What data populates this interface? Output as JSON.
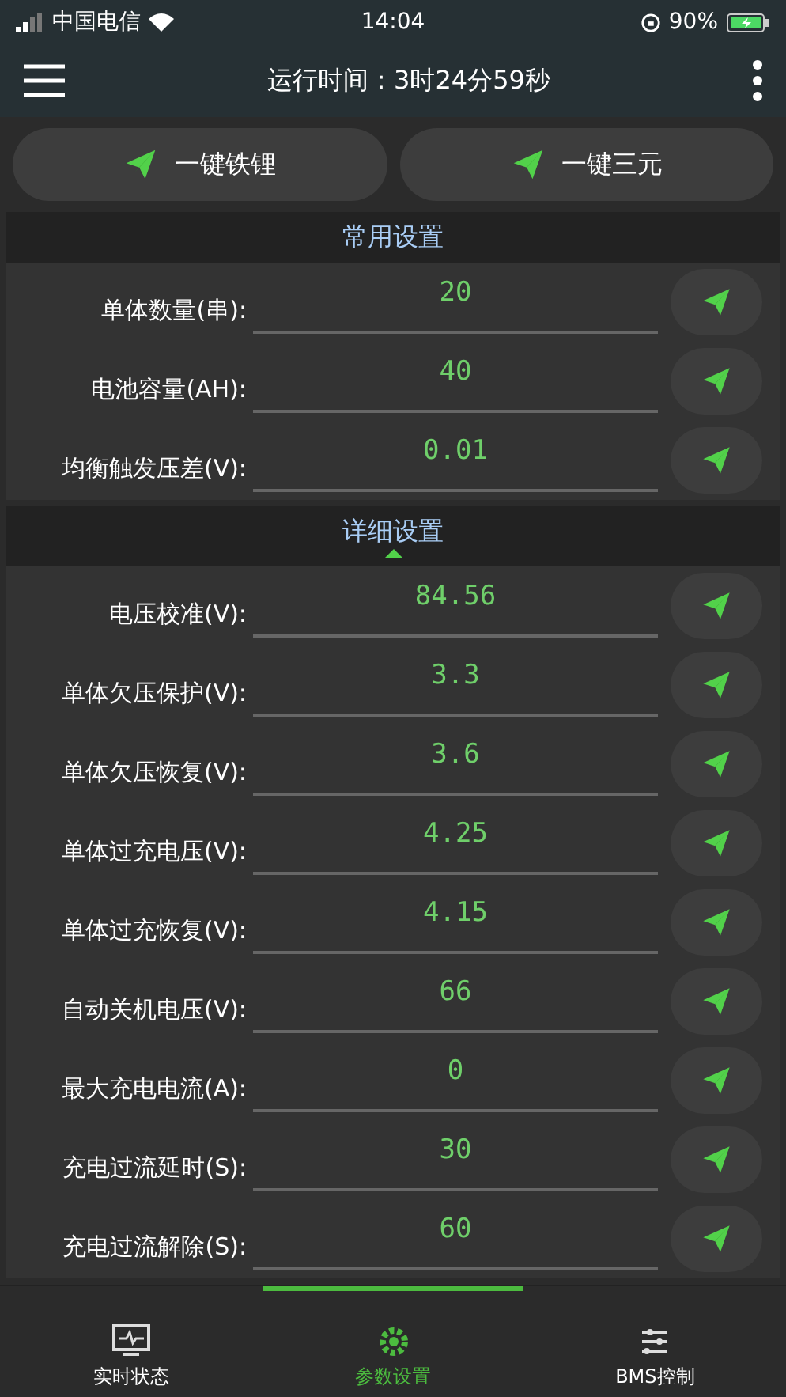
{
  "status_bar": {
    "carrier": "中国电信",
    "time": "14:04",
    "battery": "90%"
  },
  "header": {
    "title": "运行时间：3时24分59秒"
  },
  "quick_buttons": [
    "一键铁锂",
    "一键三元"
  ],
  "sections": [
    {
      "title": "常用设置",
      "expanded": false,
      "rows": [
        {
          "label": "单体数量(串):",
          "value": "20"
        },
        {
          "label": "电池容量(AH):",
          "value": "40"
        },
        {
          "label": "均衡触发压差(V):",
          "value": "0.01"
        }
      ]
    },
    {
      "title": "详细设置",
      "expanded": true,
      "rows": [
        {
          "label": "电压校准(V):",
          "value": "84.56"
        },
        {
          "label": "单体欠压保护(V):",
          "value": "3.3"
        },
        {
          "label": "单体欠压恢复(V):",
          "value": "3.6"
        },
        {
          "label": "单体过充电压(V):",
          "value": "4.25"
        },
        {
          "label": "单体过充恢复(V):",
          "value": "4.15"
        },
        {
          "label": "自动关机电压(V):",
          "value": "66"
        },
        {
          "label": "最大充电电流(A):",
          "value": "0"
        },
        {
          "label": "充电过流延时(S):",
          "value": "30"
        },
        {
          "label": "充电过流解除(S):",
          "value": "60"
        }
      ]
    }
  ],
  "bottom_nav": [
    {
      "label": "实时状态",
      "kind": "monitor",
      "selected": false
    },
    {
      "label": "参数设置",
      "kind": "gear",
      "selected": true
    },
    {
      "label": "BMS控制",
      "kind": "control",
      "selected": false
    }
  ]
}
